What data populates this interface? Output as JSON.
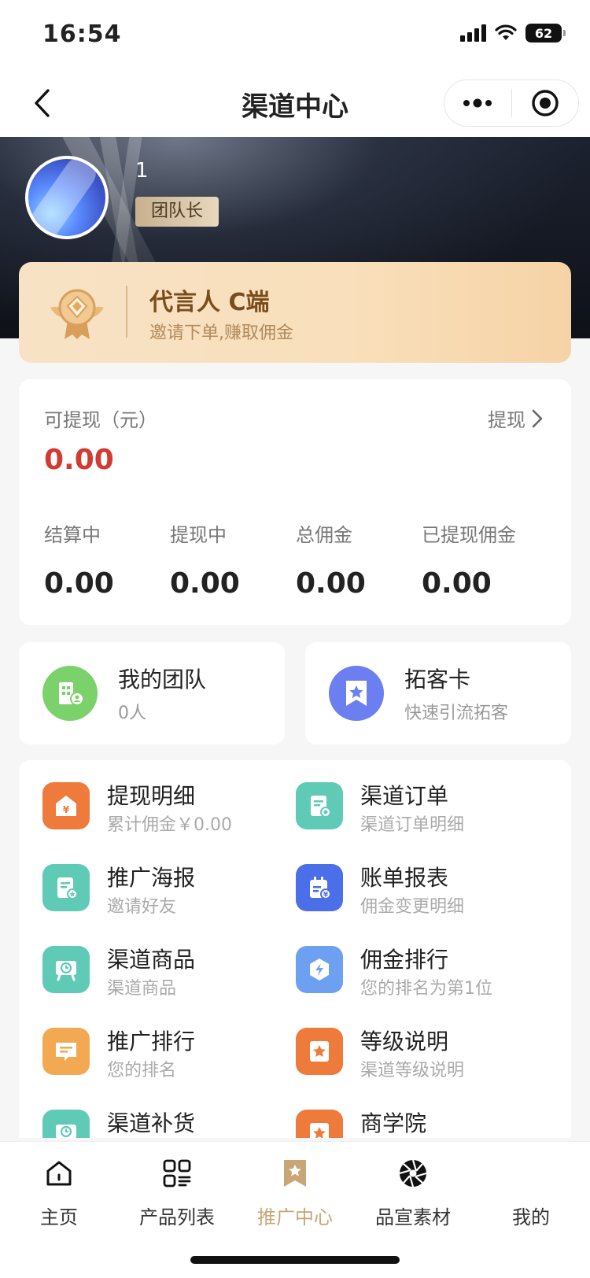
{
  "status_bar": {
    "time": "16:54",
    "battery": "62"
  },
  "nav": {
    "title": "渠道中心",
    "back_icon": "chevron-left-icon",
    "more_icon": "more-dots-icon",
    "close_icon": "target-icon"
  },
  "profile": {
    "name": "1",
    "role": "团队长"
  },
  "level_card": {
    "title": "代言人 C端",
    "subtitle": "邀请下单,赚取佣金",
    "icon": "medal-icon"
  },
  "wallet": {
    "label": "可提现（元）",
    "amount": "0.00",
    "withdraw_label": "提现",
    "stats": [
      {
        "label": "结算中",
        "value": "0.00"
      },
      {
        "label": "提现中",
        "value": "0.00"
      },
      {
        "label": "总佣金",
        "value": "0.00"
      },
      {
        "label": "已提现佣金",
        "value": "0.00"
      }
    ]
  },
  "quick_cards": [
    {
      "title": "我的团队",
      "subtitle": "0人",
      "icon": "team-building-icon",
      "color": "#7bd16a"
    },
    {
      "title": "拓客卡",
      "subtitle": "快速引流拓客",
      "icon": "star-bookmark-icon",
      "color": "#6c7ff0"
    }
  ],
  "menu": [
    {
      "title": "提现明细",
      "subtitle": "累计佣金￥0.00",
      "icon": "withdraw-detail-icon",
      "color": "#ee7a3c"
    },
    {
      "title": "渠道订单",
      "subtitle": "渠道订单明细",
      "icon": "order-doc-icon",
      "color": "#5fcbb6"
    },
    {
      "title": "推广海报",
      "subtitle": "邀请好友",
      "icon": "poster-doc-icon",
      "color": "#5fcbb6"
    },
    {
      "title": "账单报表",
      "subtitle": "佣金变更明细",
      "icon": "bill-report-icon",
      "color": "#4a6fe8"
    },
    {
      "title": "渠道商品",
      "subtitle": "渠道商品",
      "icon": "product-clock-icon",
      "color": "#5fcbb6"
    },
    {
      "title": "佣金排行",
      "subtitle": "您的排名为第1位",
      "icon": "ranking-bolt-icon",
      "color": "#6ea0f2"
    },
    {
      "title": "推广排行",
      "subtitle": "您的排名",
      "icon": "message-rank-icon",
      "color": "#f3a952"
    },
    {
      "title": "等级说明",
      "subtitle": "渠道等级说明",
      "icon": "level-star-icon",
      "color": "#ee7a3c"
    },
    {
      "title": "渠道补货",
      "subtitle": "",
      "icon": "restock-icon",
      "color": "#5fcbb6"
    },
    {
      "title": "商学院",
      "subtitle": "",
      "icon": "academy-star-icon",
      "color": "#ee7a3c"
    }
  ],
  "tabbar": [
    {
      "label": "主页",
      "icon": "home-icon",
      "active": false
    },
    {
      "label": "产品列表",
      "icon": "grid-list-icon",
      "active": false
    },
    {
      "label": "推广中心",
      "icon": "promo-bookmark-icon",
      "active": true
    },
    {
      "label": "品宣素材",
      "icon": "aperture-icon",
      "active": false
    },
    {
      "label": "我的",
      "icon": "profile-icon",
      "active": false
    }
  ],
  "colors": {
    "accent_gold": "#c8a676",
    "amount_red": "#d23a32",
    "hero_dark": "#121620"
  }
}
